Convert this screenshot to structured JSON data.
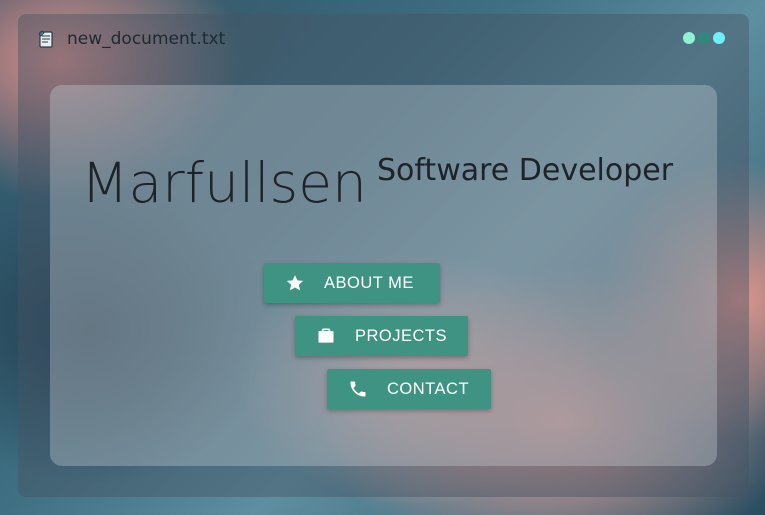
{
  "window": {
    "title": "new_document.txt",
    "file_icon": "notepad-icon",
    "controls": [
      "minimize-dot",
      "maximize-dot",
      "close-dot"
    ],
    "control_colors": [
      "#8ff2d2",
      "#2f8a7c",
      "#6ff0f5"
    ]
  },
  "hero": {
    "name": "Marfullsen",
    "role": "Software Developer"
  },
  "nav": {
    "buttons": [
      {
        "label": "ABOUT ME",
        "icon": "star-icon"
      },
      {
        "label": "PROJECTS",
        "icon": "briefcase-icon"
      },
      {
        "label": "CONTACT",
        "icon": "phone-icon"
      }
    ]
  },
  "colors": {
    "button_bg": "#3f9383",
    "text_dark": "#1e2329"
  }
}
